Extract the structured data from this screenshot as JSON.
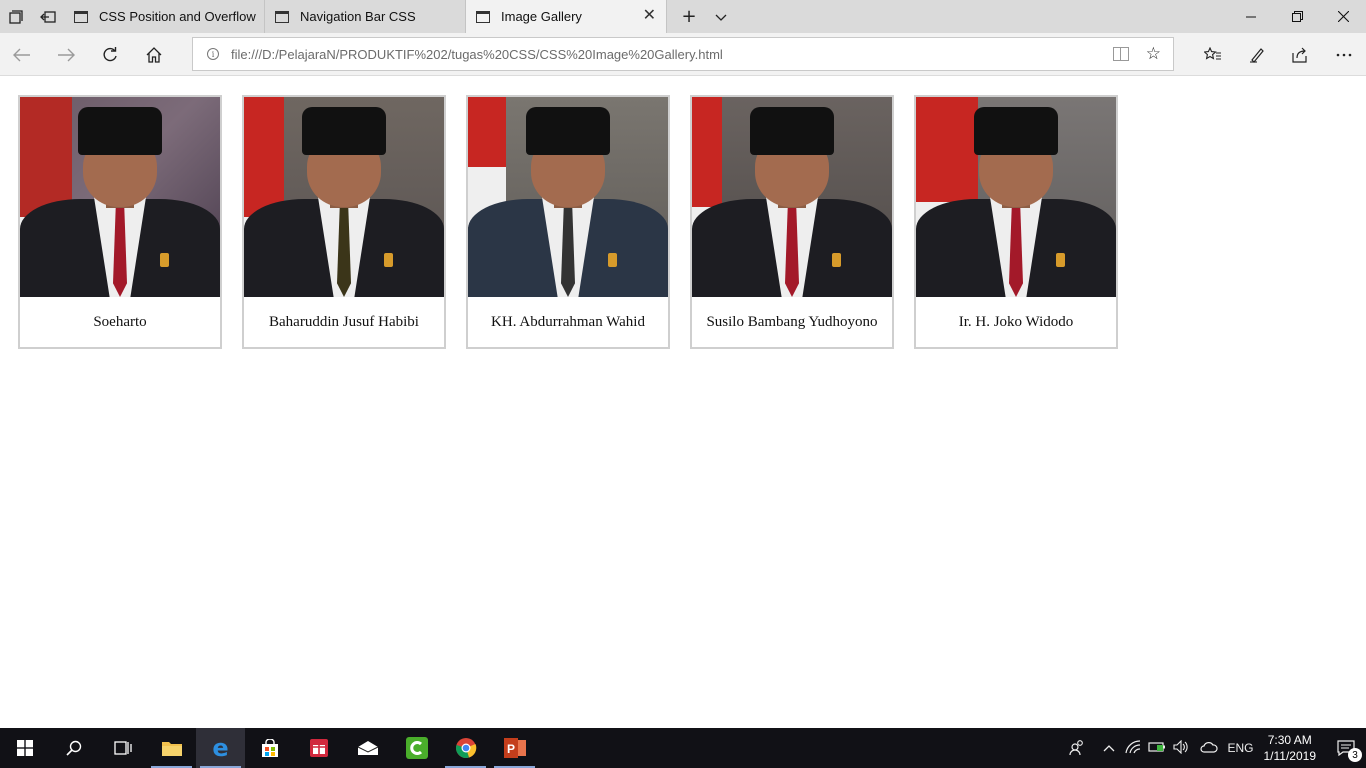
{
  "browser": {
    "tabs": [
      {
        "title": "CSS Position and Overflow",
        "active": false
      },
      {
        "title": "Navigation Bar CSS",
        "active": false
      },
      {
        "title": "Image Gallery",
        "active": true
      }
    ],
    "address_url": "file:///D:/PelajaraN/PRODUKTIF%202/tugas%20CSS/CSS%20Image%20Gallery.html"
  },
  "icons": {
    "tab_manager": "tab-manager-icon",
    "set_aside": "set-aside-tabs-icon",
    "new_tab": "plus-icon",
    "tab_list": "chevron-down-icon",
    "back": "arrow-left-icon",
    "forward": "arrow-right-icon",
    "refresh": "refresh-icon",
    "home": "home-icon",
    "favorites": "favorites-icon",
    "notes": "pen-icon",
    "share": "share-icon",
    "more": "more-icon"
  },
  "gallery": {
    "items": [
      {
        "caption": "Soeharto"
      },
      {
        "caption": "Baharuddin Jusuf Habibi"
      },
      {
        "caption": "KH. Abdurrahman Wahid"
      },
      {
        "caption": "Susilo Bambang Yudhoyono"
      },
      {
        "caption": "Ir. H. Joko Widodo"
      }
    ]
  },
  "taskbar": {
    "apps": [
      "start",
      "search",
      "task-view",
      "file-explorer",
      "edge",
      "store",
      "gift",
      "mail",
      "camtasia",
      "chrome",
      "powerpoint"
    ],
    "language": "ENG",
    "time": "7:30 AM",
    "date": "1/11/2019",
    "notification_count": "3"
  }
}
